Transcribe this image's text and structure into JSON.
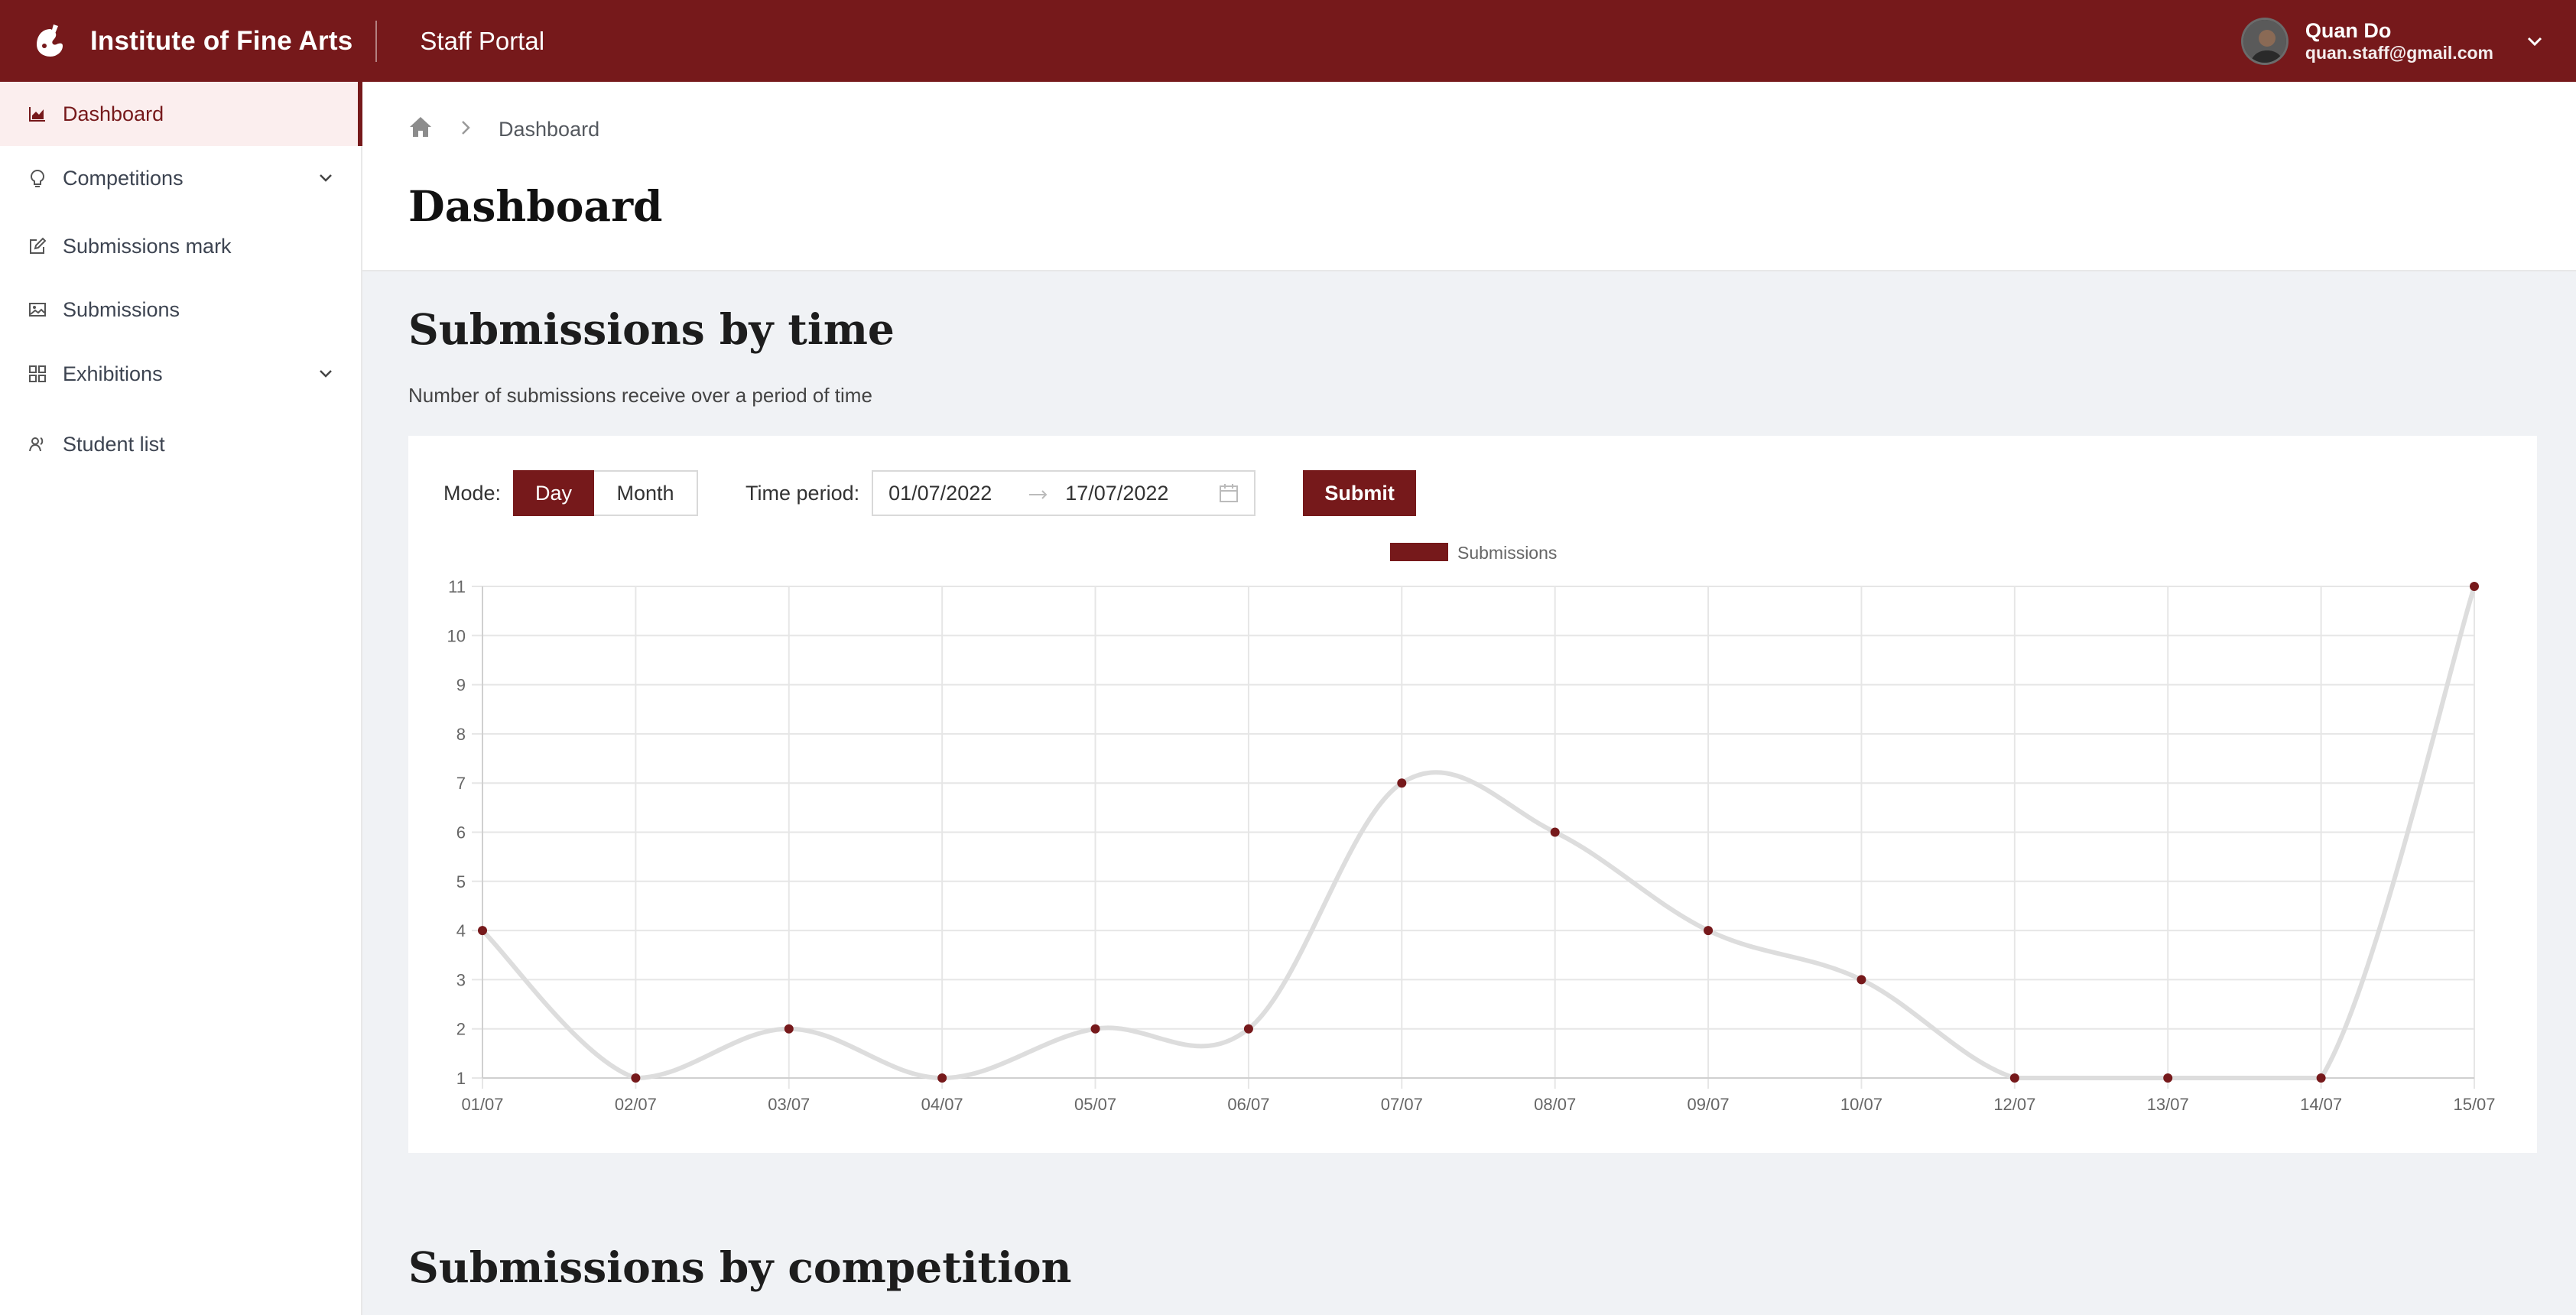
{
  "app": {
    "brand_name": "Institute of Fine Arts",
    "portal_name": "Staff Portal",
    "brand_color": "#76191b"
  },
  "user": {
    "name": "Quan Do",
    "email": "quan.staff@gmail.com",
    "menu_icon": "chevron-down-icon"
  },
  "sidebar": {
    "items": [
      {
        "label": "Dashboard",
        "icon": "area-chart-icon",
        "active": true
      },
      {
        "label": "Competitions",
        "icon": "bulb-icon",
        "expandable": true
      },
      {
        "label": "Submissions mark",
        "icon": "edit-icon"
      },
      {
        "label": "Submissions",
        "icon": "picture-icon"
      },
      {
        "label": "Exhibitions",
        "icon": "appstore-icon",
        "expandable": true
      },
      {
        "label": "Student list",
        "icon": "team-icon"
      }
    ]
  },
  "breadcrumb": {
    "home_icon": "home-icon",
    "current": "Dashboard"
  },
  "page": {
    "title": "Dashboard"
  },
  "section_time": {
    "title": "Submissions by time",
    "subtitle": "Number of submissions receive over a period of time",
    "mode_label": "Mode:",
    "mode_options": [
      "Day",
      "Month"
    ],
    "mode_selected": "Day",
    "time_period_label": "Time period:",
    "date_from": "01/07/2022",
    "date_to": "17/07/2022",
    "submit_label": "Submit"
  },
  "section_competition": {
    "title": "Submissions by competition"
  },
  "chart_data": {
    "type": "line",
    "categories": [
      "01/07",
      "02/07",
      "03/07",
      "04/07",
      "05/07",
      "06/07",
      "07/07",
      "08/07",
      "09/07",
      "10/07",
      "12/07",
      "13/07",
      "14/07",
      "15/07"
    ],
    "series": [
      {
        "name": "Submissions",
        "values": [
          4,
          1,
          2,
          1,
          2,
          2,
          7,
          6,
          4,
          3,
          1,
          1,
          1,
          11
        ],
        "point_color": "#76191b",
        "line_color": "#dddddd",
        "legend_color": "#76191b"
      }
    ],
    "y_ticks": [
      1,
      2,
      3,
      4,
      5,
      6,
      7,
      8,
      9,
      10,
      11
    ],
    "ylim": [
      1,
      11
    ],
    "grid": true,
    "legend": "top-center",
    "smooth": true
  }
}
